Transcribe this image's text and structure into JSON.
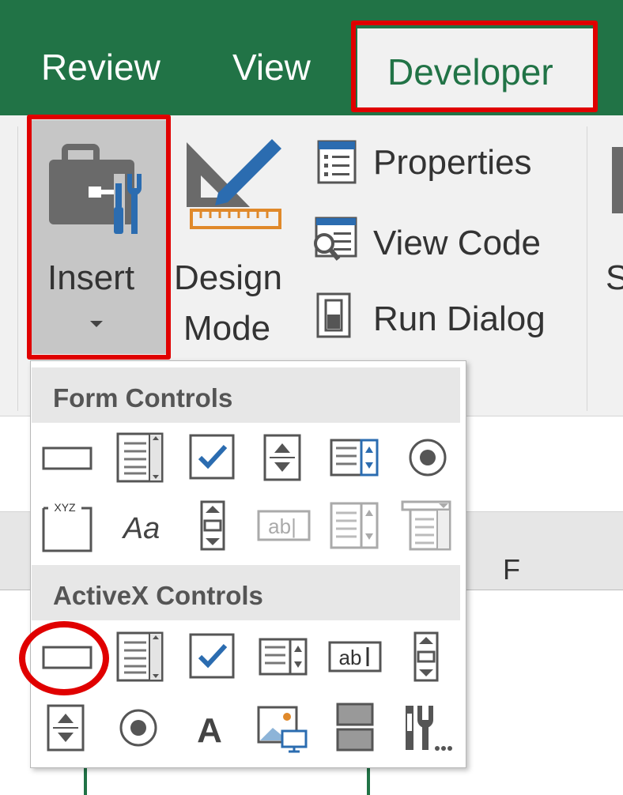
{
  "tabs": {
    "review": "Review",
    "view": "View",
    "developer": "Developer"
  },
  "ribbon": {
    "insert_label": "Insert",
    "design_mode_line1": "Design",
    "design_mode_line2": "Mode",
    "properties": "Properties",
    "view_code": "View Code",
    "run_dialog": "Run Dialog",
    "truncated_next_group": "S"
  },
  "insert_menu": {
    "form_controls_title": "Form Controls",
    "activex_controls_title": "ActiveX Controls",
    "form_controls": [
      [
        "button-icon",
        "combo-box-icon",
        "check-box-icon",
        "spin-button-icon",
        "list-box-icon",
        "option-button-icon"
      ],
      [
        "group-box-icon",
        "label-icon",
        "scroll-bar-icon",
        "text-field-icon",
        "combo-list-edit-icon",
        "combo-drop-down-edit-icon"
      ]
    ],
    "activex_controls": [
      [
        "command-button-icon",
        "combo-box-icon",
        "check-box-icon",
        "list-box-icon",
        "text-box-icon",
        "scroll-bar-icon"
      ],
      [
        "spin-button-icon",
        "option-button-icon",
        "label-icon",
        "image-icon",
        "toggle-button-icon",
        "more-controls-icon"
      ]
    ],
    "text_field_glyph": "ab|",
    "text_box_glyph": "ab",
    "label_form_glyph": "Aa",
    "label_activex_glyph": "A",
    "group_box_glyph": "XYZ"
  },
  "sheet": {
    "column_f": "F"
  },
  "colors": {
    "excel_green": "#217346",
    "highlight_red": "#e00000",
    "icon_blue": "#2b6cb0"
  }
}
